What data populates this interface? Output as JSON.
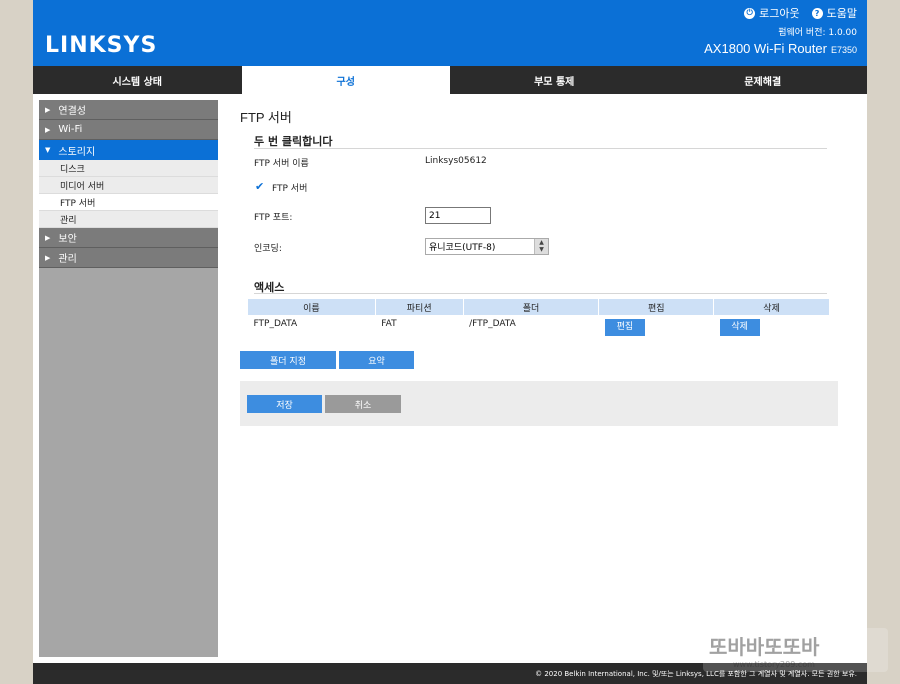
{
  "header": {
    "brand": "LINKSYS",
    "logout": "로그아웃",
    "help": "도움말",
    "firmware": "펌웨어 버전: 1.0.00",
    "model": "AX1800 Wi-Fi Router",
    "model_code": "E7350"
  },
  "tabs": [
    "시스템 상태",
    "구성",
    "부모 통제",
    "문제해결"
  ],
  "sidebar": {
    "items": [
      {
        "label": "연결성"
      },
      {
        "label": "Wi-Fi"
      },
      {
        "label": "스토리지"
      },
      {
        "label": "보안"
      },
      {
        "label": "관리"
      }
    ],
    "storage_sub": [
      "디스크",
      "미디어 서버",
      "FTP 서버",
      "관리"
    ]
  },
  "main": {
    "title": "FTP 서버",
    "section1": "두 번 클릭합니다",
    "server_name_label": "FTP 서버 이름",
    "server_name_value": "Linksys05612",
    "ftp_enable_label": "FTP 서버",
    "port_label": "FTP 포트:",
    "port_value": "21",
    "encoding_label": "인코딩:",
    "encoding_value": "유니코드(UTF-8)",
    "access_title": "액세스",
    "table": {
      "headers": [
        "이름",
        "파티션",
        "폴더",
        "편집",
        "삭제"
      ],
      "row": {
        "name": "FTP_DATA",
        "partition": "FAT",
        "folder": "/FTP_DATA",
        "edit": "편집",
        "delete": "삭제"
      }
    },
    "btn_folder": "폴더 지정",
    "btn_summary": "요약",
    "btn_save": "저장",
    "btn_cancel": "취소"
  },
  "footer": "© 2020 Belkin International, Inc. 및/또는 Linksys, LLC를 포함한 그 계열사 및 계열사. 모든 권한 보유.",
  "watermark": "또바바또또바 www.tistory209.com",
  "colors": {
    "accent": "#0b70d6",
    "button": "#3d8de0",
    "dark": "#2b2b2b"
  }
}
